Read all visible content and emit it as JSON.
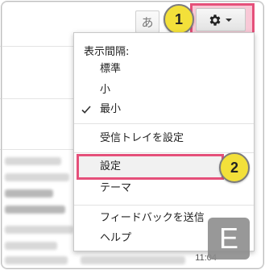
{
  "toolbar": {
    "input_tool_label": "あ",
    "settings_icon": "gear-icon",
    "settings_caret_icon": "caret-down-icon"
  },
  "callouts": [
    "1",
    "2"
  ],
  "menu": {
    "density_heading": "表示間隔:",
    "density_options": [
      "標準",
      "小",
      "最小"
    ],
    "selected_density": "最小",
    "inbox_settings": "受信トレイを設定",
    "settings": "設定",
    "theme": "テーマ",
    "feedback": "フィードバックを送信",
    "help": "ヘルプ"
  },
  "background": {
    "visible_time": "11:04"
  },
  "colors": {
    "highlight_border": "#e5507a",
    "highlight_fill": "#f8c8d6",
    "callout_fill": "#f3e03a"
  }
}
